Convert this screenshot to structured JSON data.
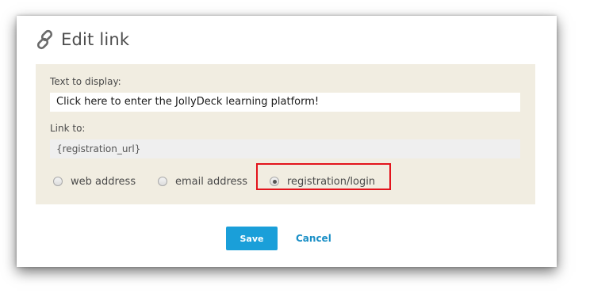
{
  "dialog": {
    "title": "Edit link",
    "title_icon": "link-icon"
  },
  "form": {
    "text_label": "Text to display:",
    "text_value": "Click here to enter the JollyDeck learning platform!",
    "link_label": "Link to:",
    "link_value": "{registration_url}",
    "link_options": [
      {
        "label": "web address",
        "selected": false
      },
      {
        "label": "email address",
        "selected": false
      },
      {
        "label": "registration/login",
        "selected": true
      }
    ]
  },
  "actions": {
    "save_label": "Save",
    "cancel_label": "Cancel"
  },
  "colors": {
    "panel_background": "#f1ede1",
    "save_button": "#1a9fd9",
    "cancel_link": "#1a8fc6",
    "highlight_outline": "#e3141c"
  }
}
